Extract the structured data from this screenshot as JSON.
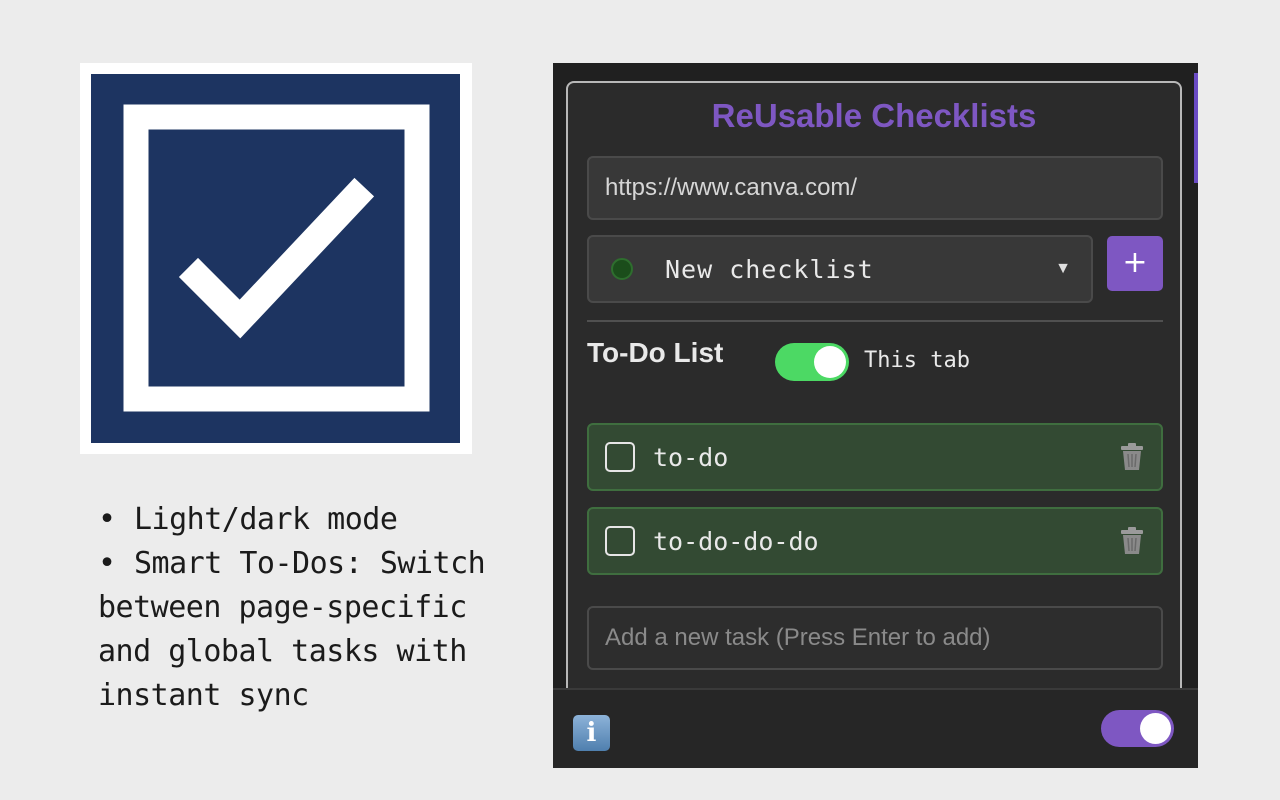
{
  "logo": {
    "icon": "checkbox-check-icon",
    "colors": {
      "background": "#1d3461",
      "stroke": "#ffffff"
    }
  },
  "features": {
    "items": [
      "Light/dark mode",
      "Smart To-Dos: Switch between page-specific and global tasks with instant sync"
    ]
  },
  "popup": {
    "title": "ReUsable Checklists",
    "url": "https://www.canva.com/",
    "checklist_select": {
      "selected": "New checklist",
      "status_color": "#1b4d1b"
    },
    "add_button_label": "+",
    "section_title": "To-Do List",
    "scope_toggle": {
      "label": "This tab",
      "on": true,
      "color": "#4cd964"
    },
    "tasks": [
      {
        "text": "to-do",
        "checked": false
      },
      {
        "text": "to-do-do-do",
        "checked": false
      }
    ],
    "new_task_placeholder": "Add a new task (Press Enter to add)",
    "footer": {
      "info_icon": "info-icon",
      "theme_toggle_on": true,
      "theme_toggle_color": "#7e57c2"
    },
    "colors": {
      "accent": "#7e57c2",
      "panel": "#2b2b2b",
      "task_bg": "#334a33"
    }
  }
}
